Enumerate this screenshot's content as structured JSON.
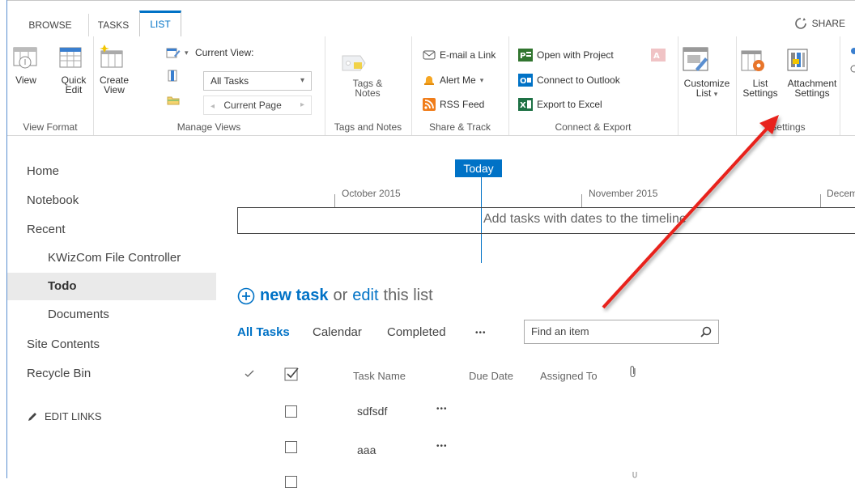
{
  "tabs": {
    "browse": "BROWSE",
    "tasks": "TASKS",
    "list": "LIST"
  },
  "share": "SHARE",
  "ribbon": {
    "view_format": {
      "view": "View",
      "quick_edit_1": "Quick",
      "quick_edit_2": "Edit",
      "label": "View Format"
    },
    "manage_views": {
      "create_view_1": "Create",
      "create_view_2": "View",
      "current_view_label": "Current View:",
      "current_view_value": "All Tasks",
      "current_page": "Current Page",
      "label": "Manage Views"
    },
    "tags_notes": {
      "btn_1": "Tags &",
      "btn_2": "Notes",
      "label": "Tags and Notes"
    },
    "share_track": {
      "email": "E-mail a Link",
      "alert": "Alert Me",
      "rss": "RSS Feed",
      "label": "Share & Track"
    },
    "connect_export": {
      "project": "Open with Project",
      "outlook": "Connect to Outlook",
      "excel": "Export to Excel",
      "label": "Connect & Export"
    },
    "customize": {
      "btn_1": "Customize",
      "btn_2": "List"
    },
    "settings": {
      "list_1": "List",
      "list_2": "Settings",
      "attach_1": "Attachment",
      "attach_2": "Settings",
      "label": "Settings"
    }
  },
  "nav": {
    "items": [
      "Home",
      "Notebook",
      "Recent",
      "KWizCom File Controller",
      "Todo",
      "Documents",
      "Site Contents",
      "Recycle Bin"
    ],
    "edit_links": "EDIT LINKS"
  },
  "timeline": {
    "today": "Today",
    "months": [
      "October 2015",
      "November 2015",
      "Decem"
    ],
    "placeholder": "Add tasks with dates to the timeline"
  },
  "list": {
    "new_task": "new task",
    "or": "or",
    "edit": "edit",
    "this_list": "this list",
    "views": [
      "All Tasks",
      "Calendar",
      "Completed",
      "•••"
    ],
    "search_placeholder": "Find an item",
    "columns": {
      "task_name": "Task Name",
      "due_date": "Due Date",
      "assigned_to": "Assigned To"
    },
    "rows": [
      {
        "task_name": "sdfsdf"
      },
      {
        "task_name": "aaa"
      }
    ],
    "row_menu": "•••"
  },
  "colors": {
    "accent": "#0072c6",
    "arrow": "#e8231a"
  }
}
